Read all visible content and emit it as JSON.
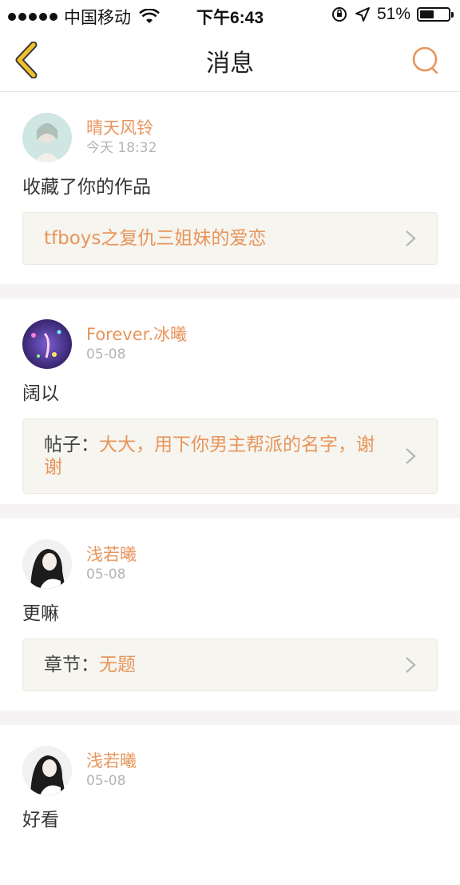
{
  "status_bar": {
    "carrier": "中国移动",
    "time": "下午6:43",
    "battery": "51%",
    "battery_level": 0.51
  },
  "nav": {
    "title": "消息"
  },
  "colors": {
    "accent": "#e8955c",
    "back_icon": "#f2c02a",
    "quote_bg": "#f6f5ef"
  },
  "messages": [
    {
      "user": "晴天风铃",
      "time": "今天 18:32",
      "body": "收藏了你的作品",
      "quote_prefix": "",
      "quote_text": "tfboys之复仇三姐妹的爱恋"
    },
    {
      "user": "Forever.冰曦",
      "time": "05-08",
      "body": "阔以",
      "quote_prefix": "帖子：",
      "quote_text": "大大，用下你男主帮派的名字，谢谢"
    },
    {
      "user": "浅若曦",
      "time": "05-08",
      "body": "更嘛",
      "quote_prefix": "章节：",
      "quote_text": "无题"
    },
    {
      "user": "浅若曦",
      "time": "05-08",
      "body": "好看"
    }
  ]
}
